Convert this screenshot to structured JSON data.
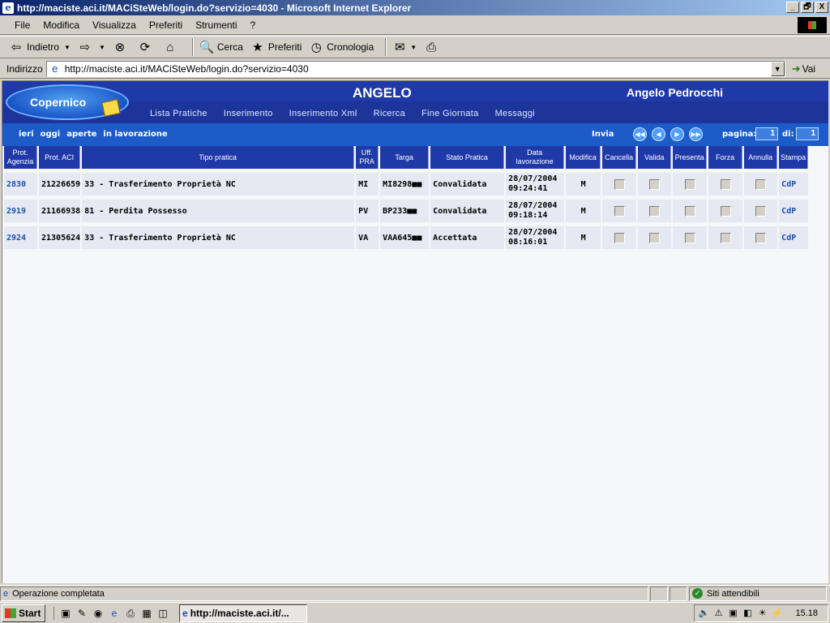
{
  "window": {
    "title": "http://maciste.aci.it/MACiSteWeb/login.do?servizio=4030 - Microsoft Internet Explorer",
    "controls": [
      "_",
      "🗗",
      "X"
    ]
  },
  "menu": [
    "File",
    "Modifica",
    "Visualizza",
    "Preferiti",
    "Strumenti",
    "?"
  ],
  "toolbar": {
    "back": "Indietro",
    "search": "Cerca",
    "favorites": "Preferiti",
    "history": "Cronologia"
  },
  "address": {
    "label": "Indirizzo",
    "url": "http://maciste.aci.it/MACiSteWeb/login.do?servizio=4030",
    "go": "Vai"
  },
  "app": {
    "logo": "Copernico",
    "title": "ANGELO",
    "user": "Angelo Pedrocchi",
    "nav": [
      "Lista Pratiche",
      "Inserimento",
      "Inserimento Xml",
      "Ricerca",
      "Fine Giornata",
      "Messaggi"
    ],
    "filters": [
      "ieri",
      "oggi",
      "aperte",
      "in lavorazione"
    ],
    "send": "Invia",
    "page_label": "pagina:",
    "page_value": "1",
    "of_label": "di:",
    "of_value": "1"
  },
  "table": {
    "headers": [
      "Prot.\nAgenzia",
      "Prot. ACI",
      "Tipo pratica",
      "Uff.\nPRA",
      "Targa",
      "Stato Pratica",
      "Data\nlavorazione",
      "Modifica",
      "Cancella",
      "Valida",
      "Presenta",
      "Forza",
      "Annulla",
      "Stampa"
    ],
    "rows": [
      {
        "prot_agenzia": "2830",
        "prot_aci": "21226659",
        "tipo": "33 - Trasferimento Proprietà NC",
        "uff": "MI",
        "targa": "MI8298■■",
        "stato": "Convalidata",
        "data": "28/07/2004",
        "ora": "09:24:41",
        "modifica": "M",
        "stampa": "CdP"
      },
      {
        "prot_agenzia": "2919",
        "prot_aci": "21166938",
        "tipo": "81 - Perdita Possesso",
        "uff": "PV",
        "targa": "BP233■■",
        "stato": "Convalidata",
        "data": "28/07/2004",
        "ora": "09:18:14",
        "modifica": "M",
        "stampa": "CdP"
      },
      {
        "prot_agenzia": "2924",
        "prot_aci": "21305624",
        "tipo": "33 - Trasferimento Proprietà NC",
        "uff": "VA",
        "targa": "VAA645■■",
        "stato": "Accettata",
        "data": "28/07/2004",
        "ora": "08:16:01",
        "modifica": "M",
        "stampa": "CdP"
      }
    ]
  },
  "status": {
    "text": "Operazione completata",
    "zone": "Siti attendibili"
  },
  "taskbar": {
    "start": "Start",
    "task": "http://maciste.aci.it/...",
    "clock": "15.18"
  }
}
